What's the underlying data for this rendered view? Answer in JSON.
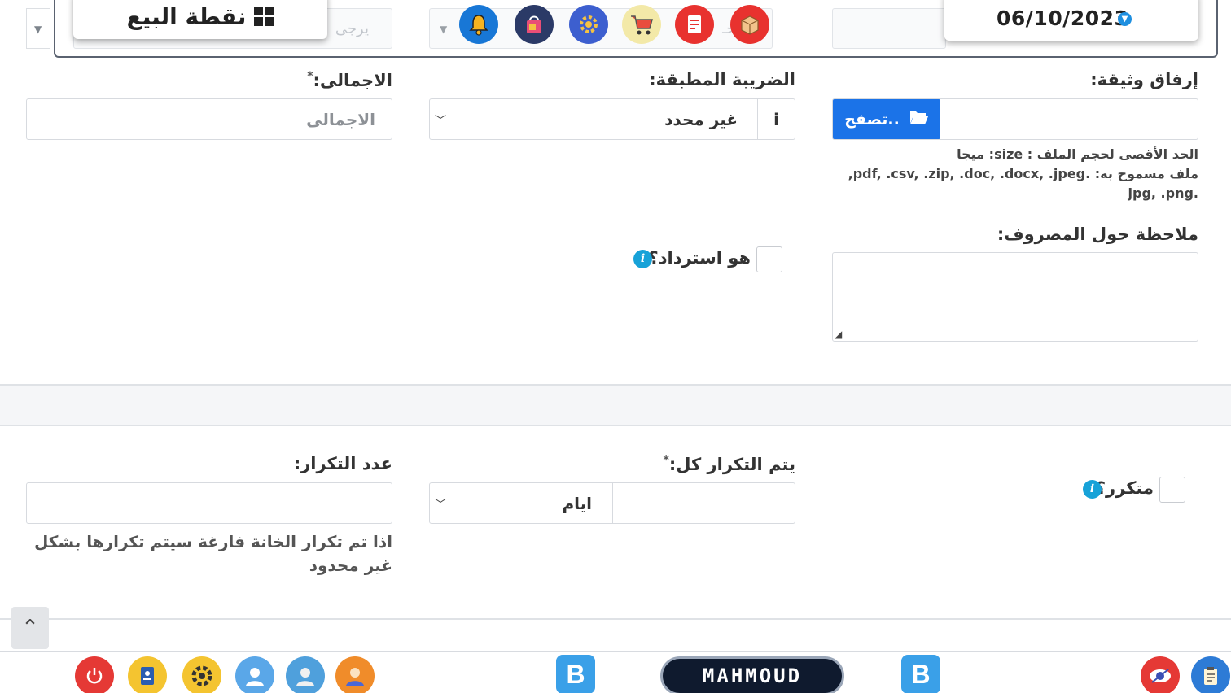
{
  "header": {
    "pos_label": "نقطة البيع",
    "date": "06/10/2023",
    "ghost_select_left": "يرجى",
    "ghost_select_mid": "عـحـ"
  },
  "form": {
    "attach_label": "إرفاق وثيقة:",
    "browse_label": "تصفح..",
    "max_size_text": "الحد الأقصى لحجم الملف : size: ميجا",
    "allowed_text_1": "ملف مسموح به: .pdf, .csv, .zip, .doc, .docx, .jpeg,",
    "allowed_text_2": ".jpg, .png",
    "tax_label": "الضريبة المطبقة:",
    "tax_value": "غير محدد",
    "total_label": "الاجمالى:",
    "total_required": "*",
    "total_placeholder": "الاجمالى",
    "note_label": "ملاحظة حول المصروف:",
    "refund_label": "هو استرداد؟"
  },
  "recurring": {
    "recurring_label": "متكرر؟",
    "every_label": "يتم التكرار كل:",
    "every_required": "*",
    "unit_value": "ايام",
    "count_label": "عدد التكرار:",
    "count_hint": "اذا تم تكرار الخانة فارغة سيتم تكرارها بشكل غير محدود"
  },
  "bottom_bar": {
    "user_name": "MAHMOUD",
    "b_label": "B"
  },
  "colors": {
    "primary": "#1b73e8",
    "info": "#17a2d8",
    "dark_pill": "#0f1a2e"
  },
  "icons": [
    "bell-icon",
    "shopping-bag-icon",
    "settings-gear-icon",
    "cart-icon",
    "document-icon",
    "box-icon",
    "power-icon",
    "contact-card-icon",
    "gear-icon",
    "user-icon",
    "user-icon",
    "user-icon",
    "eye-icon",
    "clipboard-icon"
  ]
}
